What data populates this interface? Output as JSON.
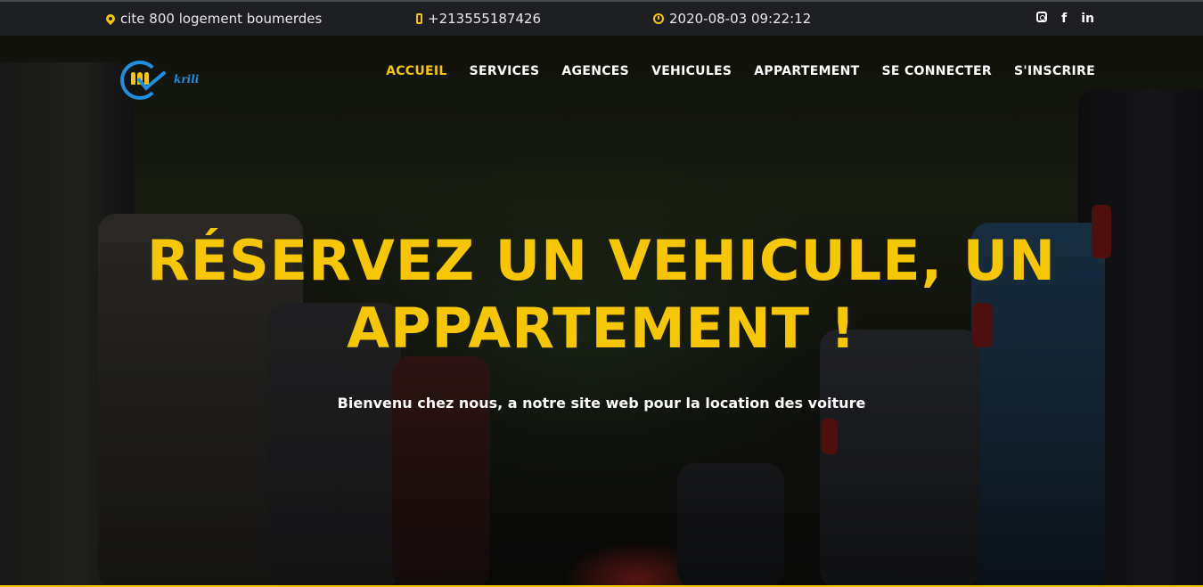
{
  "colors": {
    "accent": "#f6c700",
    "topbar_bg": "#1e1f23",
    "text": "#ffffff",
    "logo_blue": "#1f8fe0"
  },
  "topbar": {
    "address": "cite 800 logement boumerdes",
    "phone": "+213555187426",
    "datetime": "2020-08-03 09:22:12",
    "social": [
      {
        "icon": "instagram-icon"
      },
      {
        "icon": "facebook-icon",
        "glyph": "f"
      },
      {
        "icon": "linkedin-icon",
        "glyph": "in"
      }
    ]
  },
  "logo": {
    "text": "krili"
  },
  "nav": {
    "items": [
      {
        "label": "ACCUEIL",
        "active": true
      },
      {
        "label": "SERVICES"
      },
      {
        "label": "AGENCES"
      },
      {
        "label": "VEHICULES"
      },
      {
        "label": "APPARTEMENT"
      },
      {
        "label": "SE CONNECTER"
      },
      {
        "label": "S'INSCRIRE"
      }
    ]
  },
  "hero": {
    "headline_line1": "RÉSERVEZ UN VEHICULE, UN",
    "headline_line2": "APPARTEMENT !",
    "subtitle": "Bienvenu chez nous, a notre site web pour la location des voiture"
  }
}
